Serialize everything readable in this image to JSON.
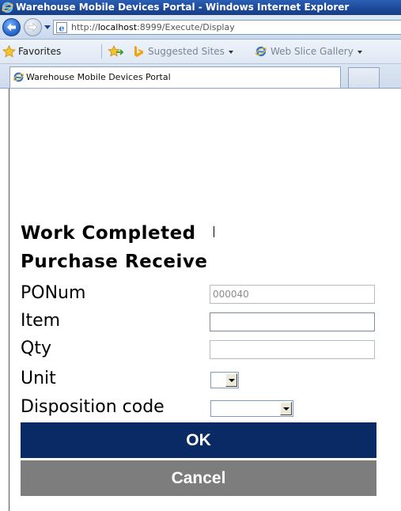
{
  "window": {
    "title": "Warehouse Mobile Devices Portal - Windows Internet Explorer"
  },
  "address_bar": {
    "url_prefix": "http://",
    "url_host": "localhost",
    "url_rest": ":8999/Execute/Display"
  },
  "favorites_bar": {
    "favorites_label": "Favorites",
    "suggested_sites_label": "Suggested Sites",
    "web_slice_label": "Web Slice Gallery"
  },
  "tabs": [
    {
      "label": "Warehouse Mobile Devices Portal",
      "active": true
    }
  ],
  "page": {
    "heading_1": "Work Completed",
    "heading_2": "Purchase Receive",
    "fields": {
      "ponum": {
        "label": "PONum",
        "value": "000040",
        "readonly": true
      },
      "item": {
        "label": "Item",
        "value": ""
      },
      "qty": {
        "label": "Qty",
        "value": ""
      },
      "unit": {
        "label": "Unit",
        "value": ""
      },
      "disposition_code": {
        "label": "Disposition code",
        "value": ""
      }
    },
    "buttons": {
      "ok": "OK",
      "cancel": "Cancel"
    }
  },
  "colors": {
    "ok_button": "#0a2a66",
    "cancel_button": "#7d7d7d",
    "title_bar": "#1d4a9a"
  },
  "icons": [
    "ie-logo-icon",
    "back-arrow-icon",
    "forward-arrow-icon",
    "page-icon",
    "favorites-star-icon",
    "add-favorite-icon",
    "bing-icon",
    "ie-page-icon"
  ]
}
